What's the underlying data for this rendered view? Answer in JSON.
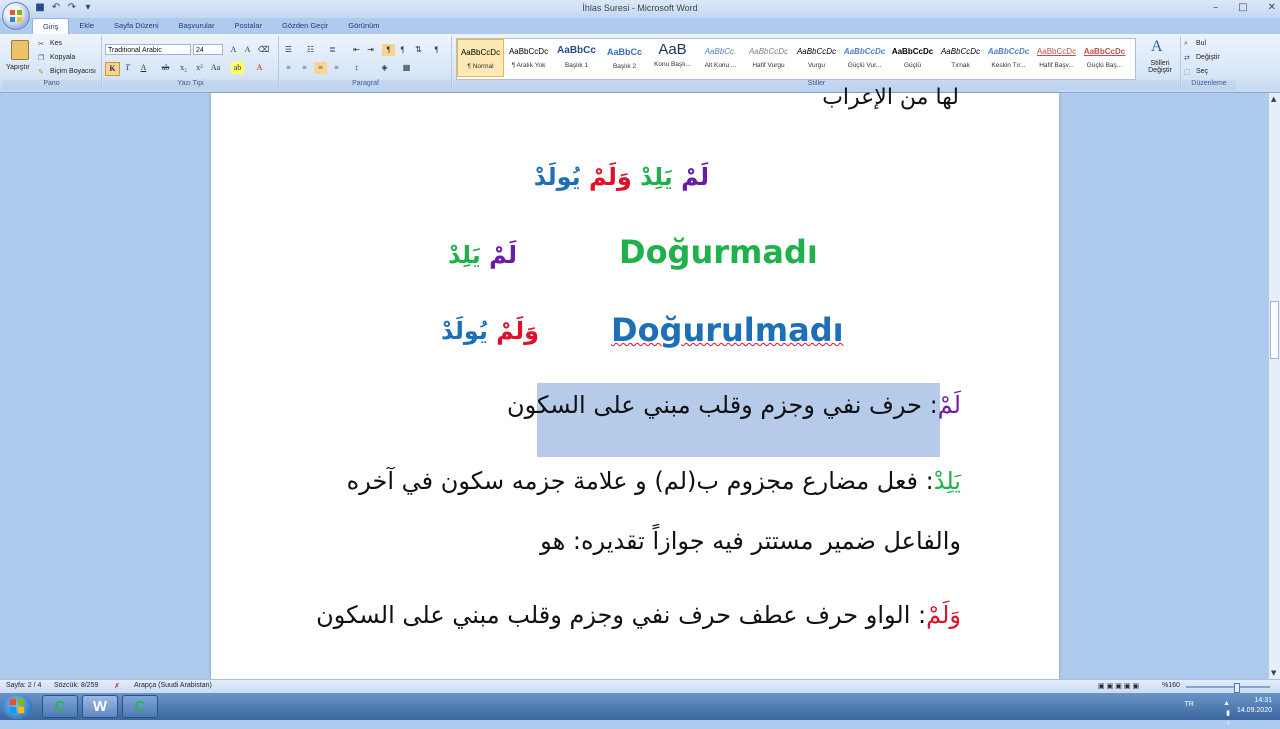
{
  "app": {
    "title": "İhlas Suresi - Microsoft Word"
  },
  "tabs": [
    "Giriş",
    "Ekle",
    "Sayfa Düzeni",
    "Başvurular",
    "Postalar",
    "Gözden Geçir",
    "Görünüm"
  ],
  "clipboard": {
    "paste": "Yapıştır",
    "cut": "Kes",
    "copy": "Kopyala",
    "format_painter": "Biçim Boyacısı",
    "label": "Pano"
  },
  "font": {
    "family": "Traditional Arabic",
    "size": "24",
    "label": "Yazı Tipi"
  },
  "paragraph": {
    "label": "Paragraf"
  },
  "styles": {
    "label": "Stiller",
    "items": [
      {
        "preview": "AaBbCcDc",
        "name": "¶ Normal"
      },
      {
        "preview": "AaBbCcDc",
        "name": "¶ Aralık Yok"
      },
      {
        "preview": "AaBbCc",
        "name": "Başlık 1"
      },
      {
        "preview": "AaBbCc",
        "name": "Başlık 2"
      },
      {
        "preview": "AaB",
        "name": "Konu Başlı..."
      },
      {
        "preview": "AaBbCc.",
        "name": "Alt Konu ..."
      },
      {
        "preview": "AaBbCcDc",
        "name": "Hafif Vurgu"
      },
      {
        "preview": "AaBbCcDc",
        "name": "Vurgu"
      },
      {
        "preview": "AaBbCcDc",
        "name": "Güçlü Vur..."
      },
      {
        "preview": "AaBbCcDc",
        "name": "Güçlü"
      },
      {
        "preview": "AaBbCcDc",
        "name": "Tırnak"
      },
      {
        "preview": "AaBbCcDc",
        "name": "Keskin Tır..."
      },
      {
        "preview": "AaBbCcDc",
        "name": "Hafif Başv..."
      },
      {
        "preview": "AaBbCcDc",
        "name": "Güçlü Baş..."
      }
    ],
    "change": "Stilleri Değiştir"
  },
  "editing": {
    "find": "Bul",
    "replace": "Değiştir",
    "select": "Seç",
    "label": "Düzenleme"
  },
  "document": {
    "top_line": "لها من الإعراب",
    "verse": {
      "w1": "لَمْ",
      "w2": "يَلِدْ",
      "w3": "وَلَمْ",
      "w4": "يُولَدْ"
    },
    "row1": {
      "w1": "لَمْ",
      "w2": "يَلِدْ",
      "meaning": "Doğurmadı"
    },
    "row2": {
      "w1": "وَلَمْ",
      "w2": "يُولَدْ",
      "meaning": "Doğurulmadı"
    },
    "p1": {
      "head": "لَمْ",
      "sep": ":",
      "text": "حرف نفي وجزم وقلب مبني على السكون"
    },
    "p2": {
      "head": "يَلِدْ",
      "sep": ":",
      "text": "فعل مضارع مجزوم ب(لم) و علامة جزمه سكون في آخره"
    },
    "p3": {
      "text": "والفاعل ضمير مستتر فيه جوازاً تقديره: هو"
    },
    "p4": {
      "head": "وَلَمْ",
      "sep": ":",
      "text": "الواو حرف عطف حرف نفي وجزم وقلب مبني على السكون"
    }
  },
  "colors": {
    "purple": "#6b1ba5",
    "green": "#1fb14b",
    "red": "#e0102a",
    "blue": "#1d6fb8"
  },
  "status": {
    "page": "Sayfa: 2 / 4",
    "words": "Sözcük: 8/259",
    "language": "Arapça (Suudi Arabistan)",
    "zoom": "%160"
  },
  "tray": {
    "lang": "TR",
    "time": "14:31",
    "date": "14.09.2020"
  }
}
